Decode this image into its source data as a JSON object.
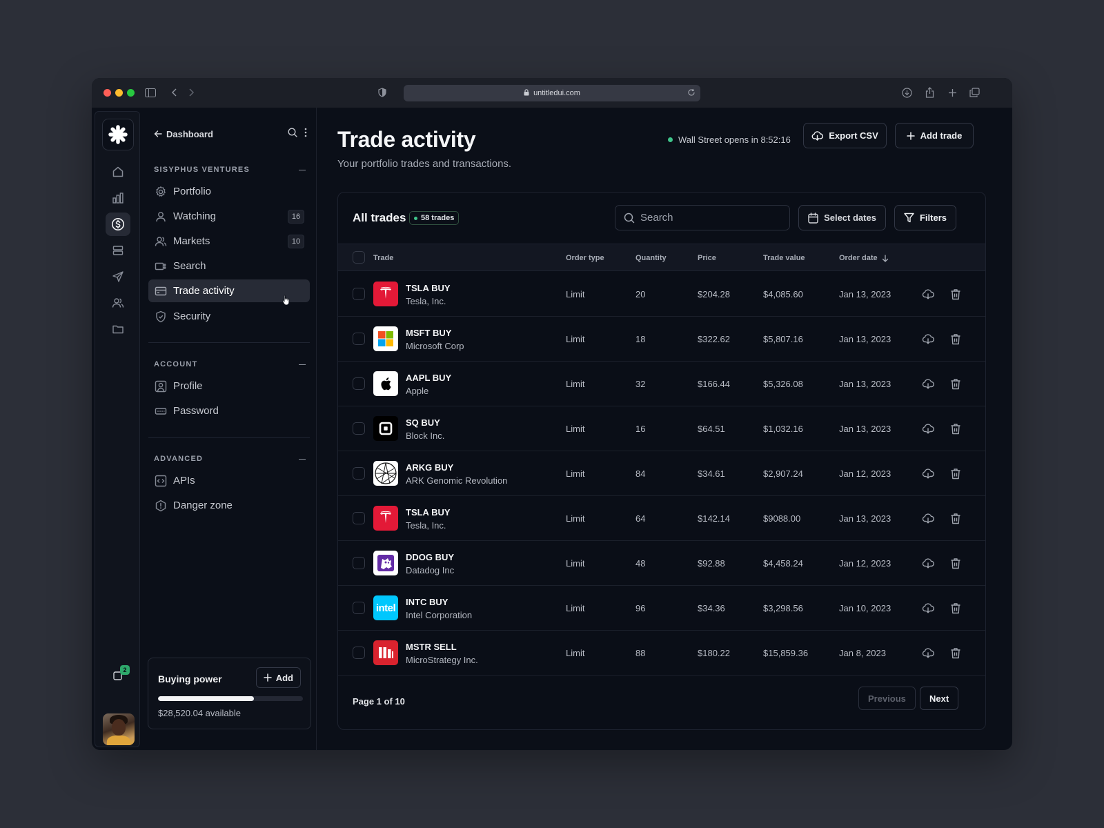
{
  "browser": {
    "url": "untitledui.com"
  },
  "rail": {
    "notification_count": "2"
  },
  "sidebar": {
    "back_label": "Dashboard",
    "sections": [
      {
        "title": "SISYPHUS VENTURES"
      },
      {
        "title": "ACCOUNT"
      },
      {
        "title": "ADVANCED"
      }
    ],
    "items": [
      {
        "label": "Portfolio"
      },
      {
        "label": "Watching",
        "count": "16"
      },
      {
        "label": "Markets",
        "count": "10"
      },
      {
        "label": "Search"
      },
      {
        "label": "Trade activity"
      },
      {
        "label": "Security"
      },
      {
        "label": "Profile"
      },
      {
        "label": "Password"
      },
      {
        "label": "APIs"
      },
      {
        "label": "Danger zone"
      }
    ],
    "buying_power": {
      "title": "Buying power",
      "add_label": "Add",
      "available": "$28,520.04 available",
      "progress_fraction": 0.66
    }
  },
  "header": {
    "title": "Trade activity",
    "subtitle": "Your portfolio trades and transactions.",
    "market_status": "Wall Street opens in 8:52:16",
    "export_label": "Export CSV",
    "add_trade_label": "Add trade"
  },
  "table": {
    "title": "All trades",
    "badge": "58 trades",
    "search_placeholder": "Search",
    "select_dates_label": "Select dates",
    "filters_label": "Filters",
    "columns": [
      "Trade",
      "Order type",
      "Quantity",
      "Price",
      "Trade value",
      "Order date"
    ],
    "rows": [
      {
        "symbol": "TSLA BUY",
        "company": "Tesla, Inc.",
        "order_type": "Limit",
        "quantity": "20",
        "price": "$204.28",
        "value": "$4,085.60",
        "date": "Jan 13, 2023",
        "logo": "tesla-logo"
      },
      {
        "symbol": "MSFT BUY",
        "company": "Microsoft Corp",
        "order_type": "Limit",
        "quantity": "18",
        "price": "$322.62",
        "value": "$5,807.16",
        "date": "Jan 13, 2023",
        "logo": "microsoft-logo"
      },
      {
        "symbol": "AAPL BUY",
        "company": "Apple",
        "order_type": "Limit",
        "quantity": "32",
        "price": "$166.44",
        "value": "$5,326.08",
        "date": "Jan 13, 2023",
        "logo": "apple-logo"
      },
      {
        "symbol": "SQ BUY",
        "company": "Block Inc.",
        "order_type": "Limit",
        "quantity": "16",
        "price": "$64.51",
        "value": "$1,032.16",
        "date": "Jan 13, 2023",
        "logo": "block-logo"
      },
      {
        "symbol": "ARKG BUY",
        "company": "ARK Genomic Revolution",
        "order_type": "Limit",
        "quantity": "84",
        "price": "$34.61",
        "value": "$2,907.24",
        "date": "Jan 12, 2023",
        "logo": "ark-logo"
      },
      {
        "symbol": "TSLA BUY",
        "company": "Tesla, Inc.",
        "order_type": "Limit",
        "quantity": "64",
        "price": "$142.14",
        "value": "$9088.00",
        "date": "Jan 13, 2023",
        "logo": "tesla-logo"
      },
      {
        "symbol": "DDOG BUY",
        "company": "Datadog Inc",
        "order_type": "Limit",
        "quantity": "48",
        "price": "$92.88",
        "value": "$4,458.24",
        "date": "Jan 12, 2023",
        "logo": "datadog-logo"
      },
      {
        "symbol": "INTC BUY",
        "company": "Intel Corporation",
        "order_type": "Limit",
        "quantity": "96",
        "price": "$34.36",
        "value": "$3,298.56",
        "date": "Jan 10, 2023",
        "logo": "intel-logo"
      },
      {
        "symbol": "MSTR SELL",
        "company": "MicroStrategy Inc.",
        "order_type": "Limit",
        "quantity": "88",
        "price": "$180.22",
        "value": "$15,859.36",
        "date": "Jan 8, 2023",
        "logo": "microstrategy-logo"
      }
    ],
    "page_info": "Page 1 of 10",
    "previous_label": "Previous",
    "next_label": "Next",
    "intel_wordmark": "intel"
  }
}
